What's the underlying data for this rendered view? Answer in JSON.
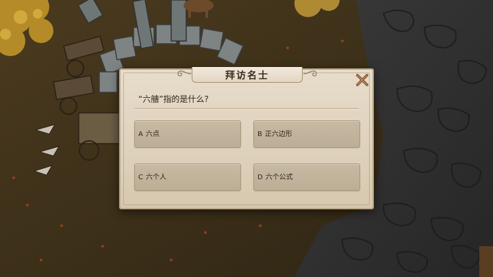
{
  "dialog": {
    "title": "拜访名士",
    "question": "“六艢”指的是什么?",
    "close_icon": "close-x-icon"
  },
  "options": [
    {
      "letter": "A",
      "text": "六点"
    },
    {
      "letter": "B",
      "text": "正六边形"
    },
    {
      "letter": "C",
      "text": "六个人"
    },
    {
      "letter": "D",
      "text": "六个公式"
    }
  ],
  "colors": {
    "panel": "#e2d6c3",
    "option": "#c2b49d",
    "text": "#2e2418",
    "close": "#8a5a3a"
  }
}
